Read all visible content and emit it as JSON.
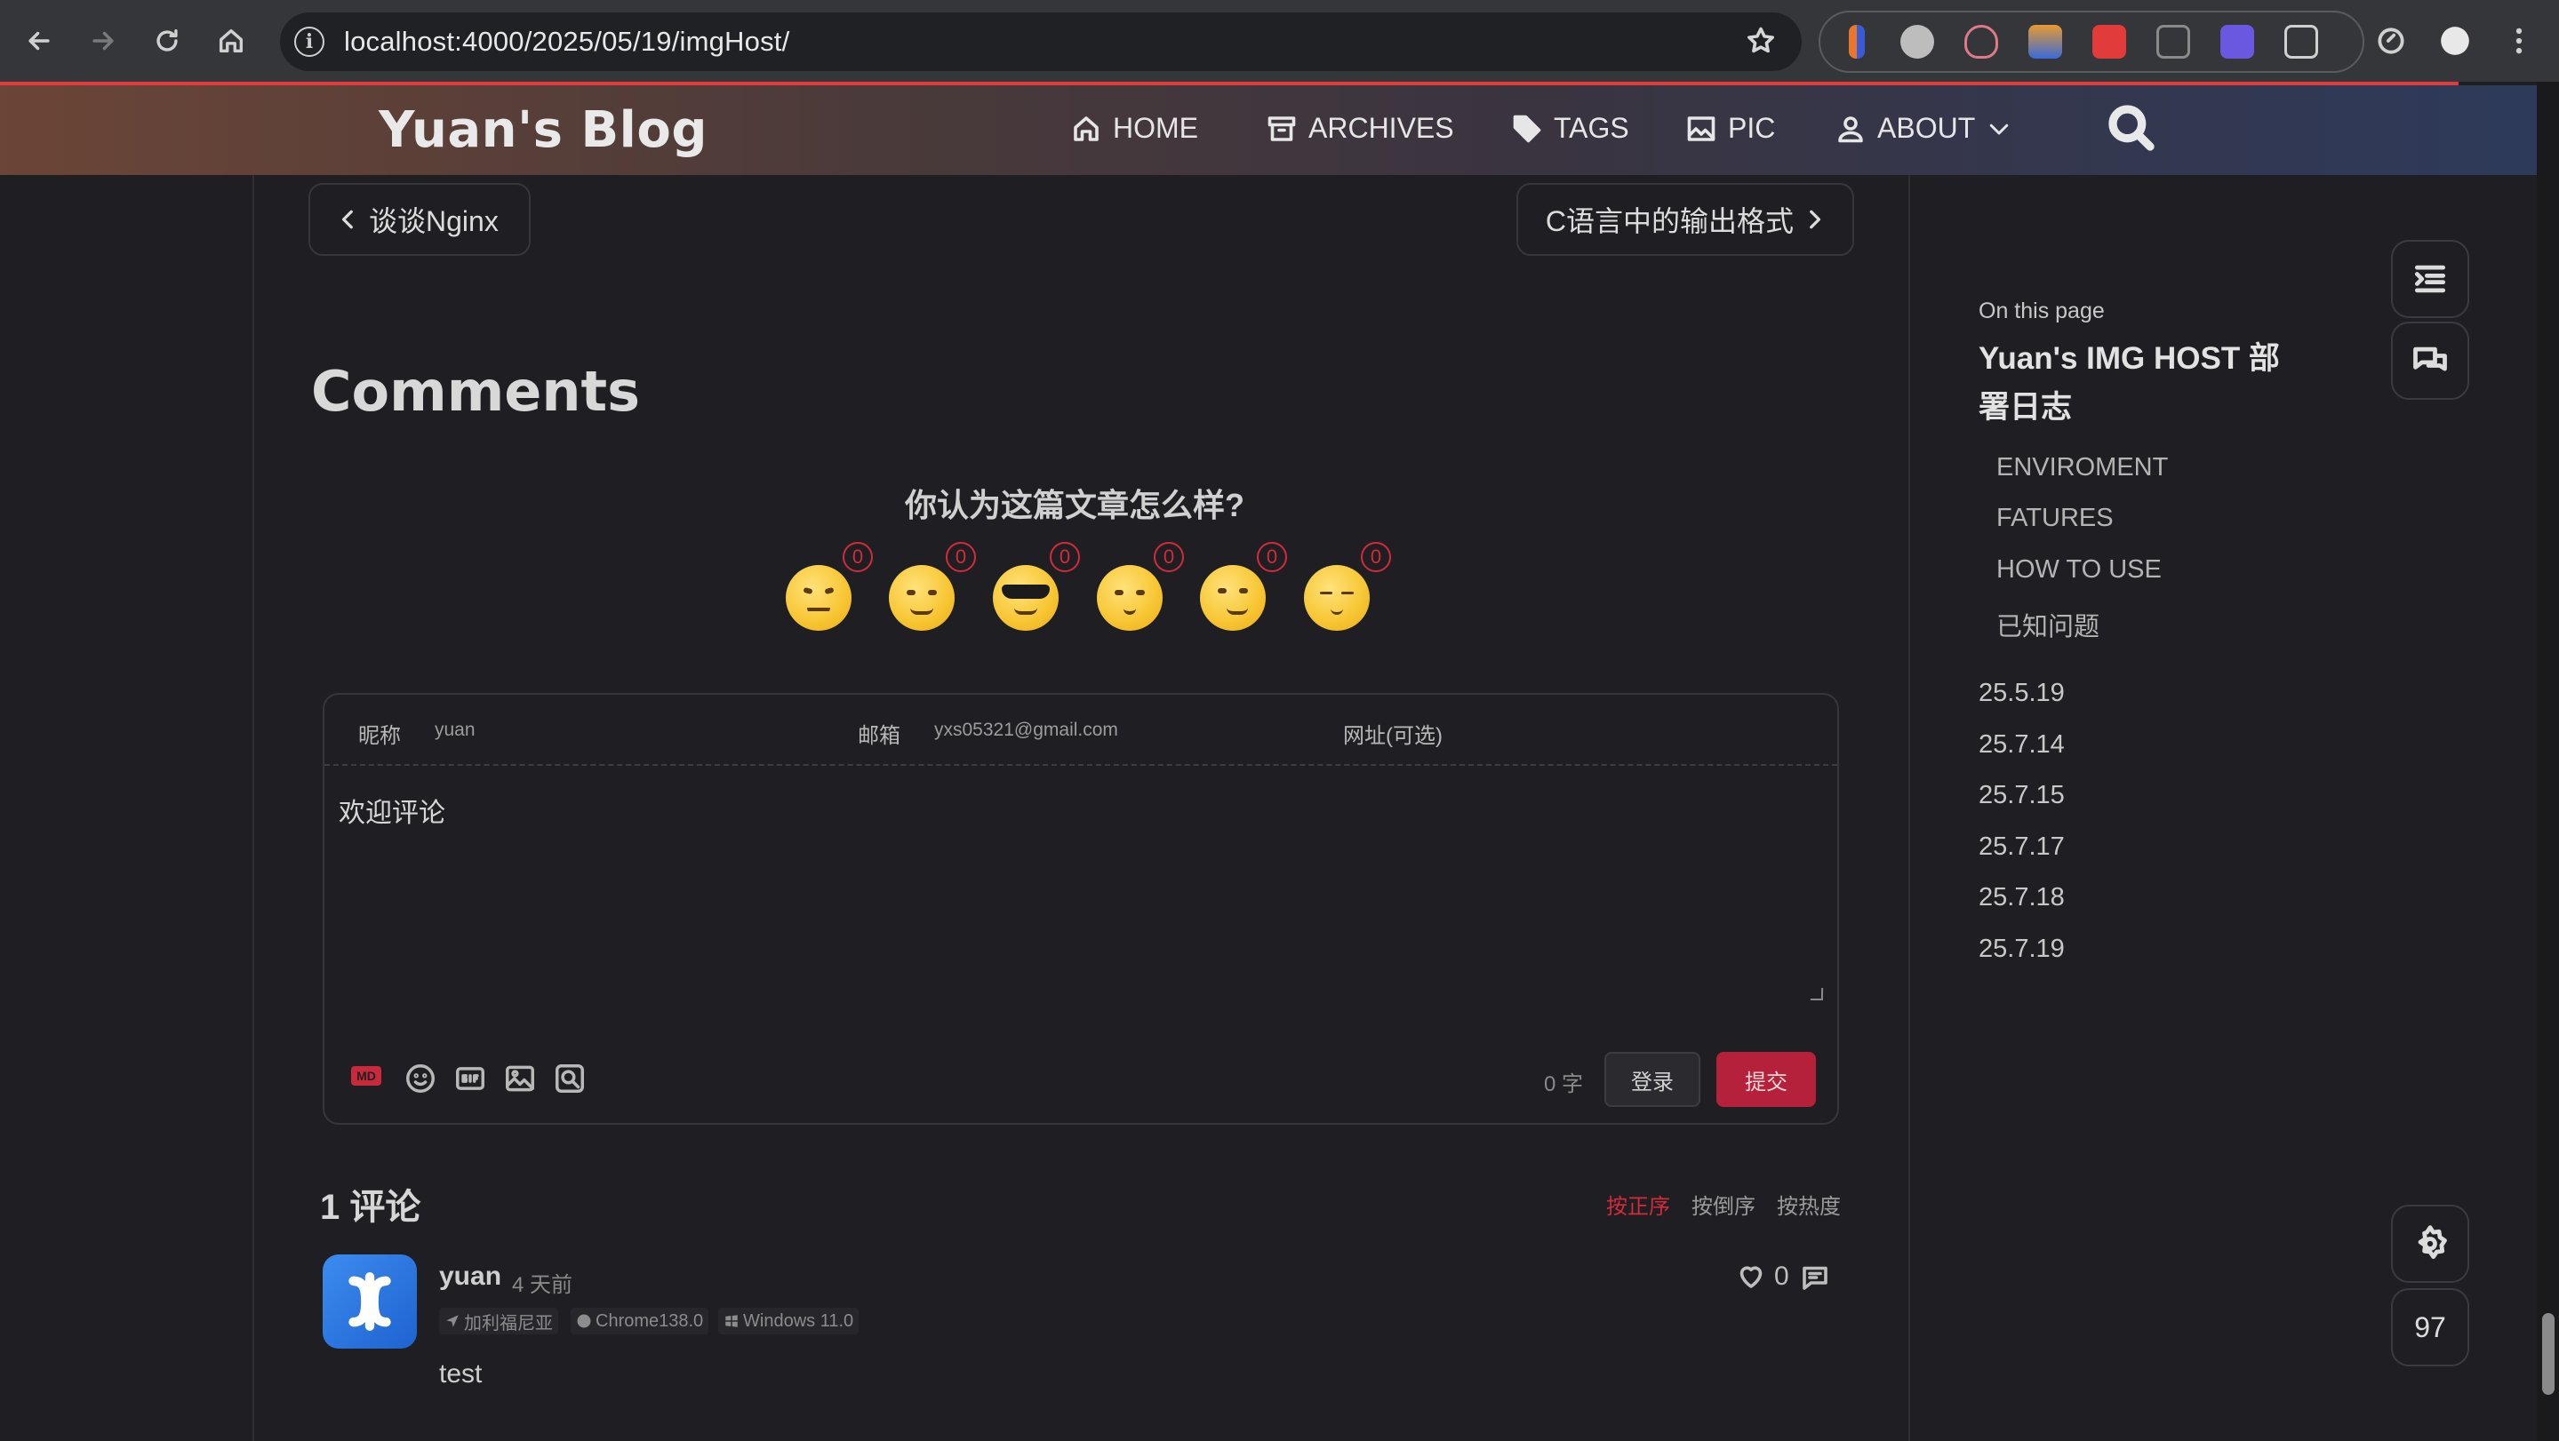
{
  "browser": {
    "url": "localhost:4000/2025/05/19/imgHost/"
  },
  "site": {
    "title": "Yuan's Blog",
    "menu": [
      {
        "label": "HOME",
        "icon": "home-icon"
      },
      {
        "label": "ARCHIVES",
        "icon": "archive-icon"
      },
      {
        "label": "TAGS",
        "icon": "tag-icon"
      },
      {
        "label": "PIC",
        "icon": "image-icon"
      },
      {
        "label": "ABOUT",
        "icon": "user-icon"
      }
    ]
  },
  "post_nav": {
    "prev": "谈谈Nginx",
    "next": "C语言中的输出格式"
  },
  "comments": {
    "title": "Comments",
    "reaction_question": "你认为这篇文章怎么样?",
    "reactions": [
      {
        "icon": "thinking-emoji-icon",
        "count": "0"
      },
      {
        "icon": "hug-emoji-icon",
        "count": "0"
      },
      {
        "icon": "cool-emoji-icon",
        "count": "0"
      },
      {
        "icon": "shush-emoji-icon",
        "count": "0"
      },
      {
        "icon": "smirk-emoji-icon",
        "count": "0"
      },
      {
        "icon": "sleepy-emoji-icon",
        "count": "0"
      }
    ],
    "form": {
      "nickname_label": "昵称",
      "nickname_value": "yuan",
      "email_label": "邮箱",
      "email_value": "yxs05321@gmail.com",
      "website_label": "网址(可选)",
      "placeholder": "欢迎评论",
      "md_badge": "MD",
      "word_count": "0 字",
      "login_label": "登录",
      "submit_label": "提交"
    },
    "count_title": "1 评论",
    "sort_options": [
      "按正序",
      "按倒序",
      "按热度"
    ],
    "items": [
      {
        "author": "yuan",
        "time": "4 天前",
        "location": "加利福尼亚",
        "browser": "Chrome138.0",
        "os": "Windows 11.0",
        "text": "test",
        "likes": "0"
      }
    ]
  },
  "toc": {
    "caption": "On this page",
    "title": "Yuan's IMG HOST 部署日志",
    "sub_items": [
      "ENVIROMENT",
      "FATURES",
      "HOW TO USE",
      "已知问题"
    ],
    "items": [
      "25.5.19",
      "25.7.14",
      "25.7.15",
      "25.7.17",
      "25.7.18",
      "25.7.19"
    ]
  },
  "side_tools": {
    "scroll_percent": "97"
  },
  "colors": {
    "accent": "#b5203a",
    "background": "#1f1f23"
  }
}
